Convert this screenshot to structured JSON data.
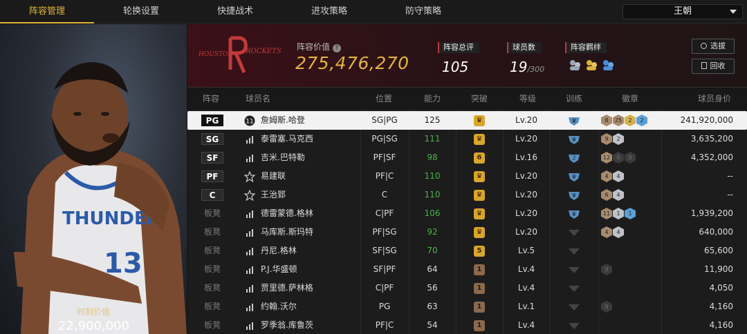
{
  "nav": {
    "tabs": [
      "阵容管理",
      "轮换设置",
      "快捷战术",
      "进攻策略",
      "防守策略"
    ],
    "active_tab": 0,
    "team_select": "王朝"
  },
  "portrait": {
    "label": "时刻价值",
    "value": "22,900,000"
  },
  "summary": {
    "logo_text_left": "HOUSTON",
    "logo_text_right": "ROCKETS",
    "lineup_value_label": "阵容价值",
    "lineup_value": "275,476,270",
    "rating_label": "阵容总评",
    "rating_value": "105",
    "player_count_label": "球员数",
    "player_count": "19",
    "player_count_max": "/300",
    "bond_label": "阵容羁绊",
    "select_button": "选拔",
    "recall_button": "回收"
  },
  "table": {
    "headers": [
      "阵容",
      "球员名",
      "位置",
      "能力",
      "突破",
      "等级",
      "训练",
      "徽章",
      "球员身价"
    ],
    "rows": [
      {
        "slot": "PG",
        "starter": true,
        "icon": "11",
        "name": "詹姆斯.哈登",
        "pos": "SG|PG",
        "ability": "125",
        "green": false,
        "breakthrough": "crown",
        "bk_color": "gold",
        "level": "Lv.20",
        "train": "crown",
        "badges": [
          [
            "bronze",
            "8"
          ],
          [
            "bronze",
            "25"
          ],
          [
            "gold",
            "2"
          ],
          [
            "blue",
            "2"
          ]
        ],
        "value": "241,920,000",
        "selected": true
      },
      {
        "slot": "SG",
        "starter": true,
        "icon": "bars",
        "name": "泰雷塞.马克西",
        "pos": "PG|SG",
        "ability": "111",
        "green": true,
        "breakthrough": "crown",
        "bk_color": "gold",
        "level": "Lv.20",
        "train": "crown",
        "badges": [
          [
            "bronze",
            "9"
          ],
          [
            "silver",
            "2"
          ]
        ],
        "value": "3,635,200"
      },
      {
        "slot": "SF",
        "starter": true,
        "icon": "bars",
        "name": "吉米.巴特勒",
        "pos": "PF|SF",
        "ability": "98",
        "green": true,
        "breakthrough": "6",
        "bk_color": "gold",
        "level": "Lv.16",
        "train": "2",
        "badges": [
          [
            "bronze",
            "12"
          ],
          [
            "dark",
            "0"
          ],
          [
            "dark",
            "0"
          ]
        ],
        "value": "4,352,000"
      },
      {
        "slot": "PF",
        "starter": true,
        "icon": "star",
        "name": "易建联",
        "pos": "PF|C",
        "ability": "110",
        "green": true,
        "breakthrough": "crown",
        "bk_color": "gold",
        "level": "Lv.20",
        "train": "crown",
        "badges": [
          [
            "bronze",
            "4"
          ],
          [
            "silver",
            "4"
          ]
        ],
        "value": "--"
      },
      {
        "slot": "C",
        "starter": true,
        "icon": "star",
        "name": "王治郅",
        "pos": "C",
        "ability": "110",
        "green": true,
        "breakthrough": "crown",
        "bk_color": "gold",
        "level": "Lv.20",
        "train": "crown",
        "badges": [
          [
            "bronze",
            "6"
          ],
          [
            "silver",
            "4"
          ]
        ],
        "value": "--"
      },
      {
        "slot": "板凳",
        "starter": false,
        "icon": "bars",
        "name": "德雷蒙德.格林",
        "pos": "C|PF",
        "ability": "106",
        "green": true,
        "breakthrough": "crown",
        "bk_color": "gold",
        "level": "Lv.20",
        "train": "crown",
        "badges": [
          [
            "bronze",
            "11"
          ],
          [
            "silver",
            "1"
          ],
          [
            "blue",
            "1"
          ]
        ],
        "value": "1,939,200"
      },
      {
        "slot": "板凳",
        "starter": false,
        "icon": "bars",
        "name": "马库斯.斯玛特",
        "pos": "PF|SG",
        "ability": "92",
        "green": true,
        "breakthrough": "crown",
        "bk_color": "gold",
        "level": "Lv.20",
        "train": "empty",
        "badges": [
          [
            "bronze",
            "4"
          ],
          [
            "silver",
            "4"
          ]
        ],
        "value": "640,000"
      },
      {
        "slot": "板凳",
        "starter": false,
        "icon": "bars",
        "name": "丹尼.格林",
        "pos": "SF|SG",
        "ability": "70",
        "green": true,
        "breakthrough": "5",
        "bk_color": "gold",
        "level": "Lv.5",
        "train": "empty",
        "badges": [],
        "value": "65,600"
      },
      {
        "slot": "板凳",
        "starter": false,
        "icon": "bars",
        "name": "P.J.华盛顿",
        "pos": "SF|PF",
        "ability": "64",
        "green": false,
        "breakthrough": "1",
        "bk_color": "bronze",
        "level": "Lv.4",
        "train": "empty",
        "badges": [
          [
            "dark",
            "0"
          ]
        ],
        "value": "11,900"
      },
      {
        "slot": "板凳",
        "starter": false,
        "icon": "bars",
        "name": "贾里德.萨林格",
        "pos": "C|PF",
        "ability": "56",
        "green": false,
        "breakthrough": "1",
        "bk_color": "bronze",
        "level": "Lv.4",
        "train": "empty",
        "badges": [],
        "value": "4,050"
      },
      {
        "slot": "板凳",
        "starter": false,
        "icon": "bars",
        "name": "约翰.沃尔",
        "pos": "PG",
        "ability": "63",
        "green": false,
        "breakthrough": "1",
        "bk_color": "bronze",
        "level": "Lv.1",
        "train": "empty",
        "badges": [
          [
            "dark",
            "0"
          ]
        ],
        "value": "4,160"
      },
      {
        "slot": "板凳",
        "starter": false,
        "icon": "bars",
        "name": "罗季翁.库鲁茨",
        "pos": "PF|C",
        "ability": "54",
        "green": false,
        "breakthrough": "1",
        "bk_color": "bronze",
        "level": "Lv.4",
        "train": "empty",
        "badges": [],
        "value": "4,160"
      }
    ]
  },
  "colors": {
    "accent": "#e6b53a",
    "green": "#4fb04a",
    "header_red": "#3c1017"
  }
}
